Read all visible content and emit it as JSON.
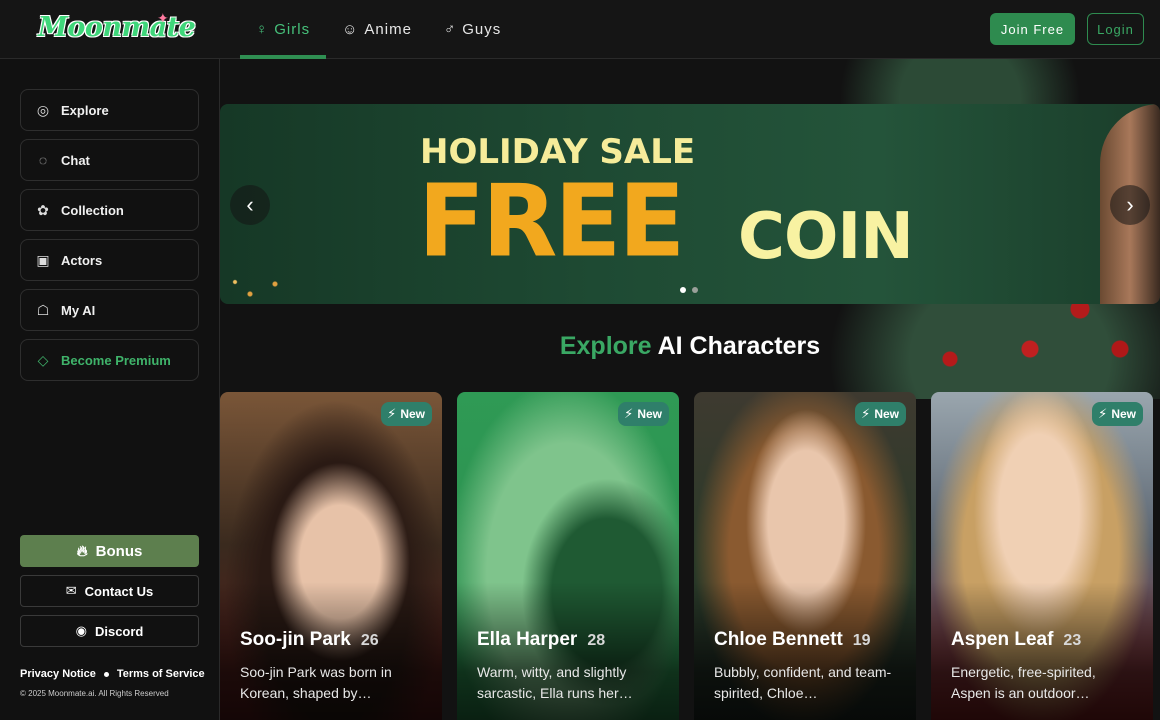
{
  "header": {
    "logo_text": "Moonmate",
    "tabs": [
      {
        "label": "Girls",
        "icon": "female-icon",
        "active": true
      },
      {
        "label": "Anime",
        "icon": "cat-face-icon",
        "active": false
      },
      {
        "label": "Guys",
        "icon": "male-icon",
        "active": false
      }
    ],
    "join_label": "Join Free",
    "login_label": "Login"
  },
  "sidebar": {
    "items": [
      {
        "label": "Explore",
        "icon": "planet-icon"
      },
      {
        "label": "Chat",
        "icon": "chat-bubble-icon"
      },
      {
        "label": "Collection",
        "icon": "collection-icon"
      },
      {
        "label": "Actors",
        "icon": "actors-icon"
      },
      {
        "label": "My AI",
        "icon": "robot-icon"
      },
      {
        "label": "Become Premium",
        "icon": "diamond-icon"
      }
    ],
    "bonus_label": "Bonus",
    "contact_label": "Contact Us",
    "discord_label": "Discord",
    "privacy_label": "Privacy Notice",
    "terms_label": "Terms of Service",
    "copyright": "© 2025 Moonmate.ai. All Rights Reserved"
  },
  "banner": {
    "line1": "HOLIDAY SALE",
    "line2_big": "FREE",
    "line2_small": "COIN",
    "slide_count": 2,
    "active_slide": 1
  },
  "section": {
    "title_accent": "Explore",
    "title_rest": "AI Characters"
  },
  "cards": [
    {
      "name": "Soo-jin Park",
      "age": "26",
      "badge": "New",
      "desc": "Soo-jin Park was born in Korean, shaped by…"
    },
    {
      "name": "Ella Harper",
      "age": "28",
      "badge": "New",
      "desc": "Warm, witty, and slightly sarcastic, Ella runs her…"
    },
    {
      "name": "Chloe Bennett",
      "age": "19",
      "badge": "New",
      "desc": "Bubbly, confident, and team-spirited, Chloe…"
    },
    {
      "name": "Aspen Leaf",
      "age": "23",
      "badge": "New",
      "desc": "Energetic, free-spirited, Aspen is an outdoor…"
    }
  ],
  "colors": {
    "accent_green": "#2e8b4f",
    "premium_green": "#3fb36a",
    "bonus_bg": "#5d7f4e",
    "banner_orange": "#f2a81e",
    "banner_cream": "#f8f2a2"
  }
}
